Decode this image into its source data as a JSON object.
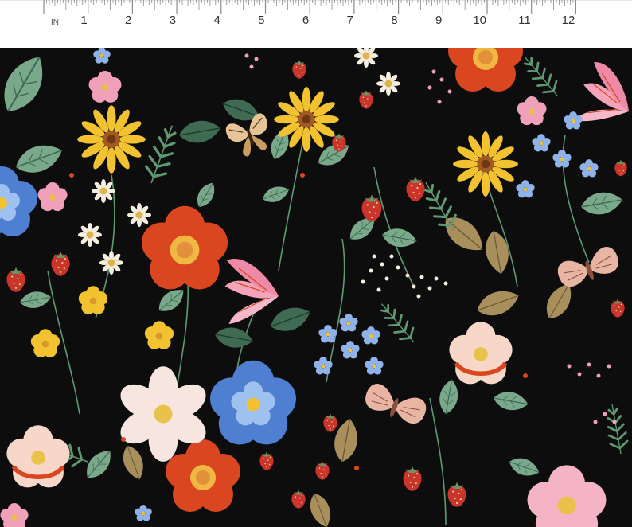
{
  "ruler": {
    "unit_label": "IN",
    "numbers": [
      "1",
      "2",
      "3",
      "4",
      "5",
      "6",
      "7",
      "8",
      "9",
      "10",
      "11",
      "12"
    ]
  },
  "colors": {
    "background": "#0d0d0d",
    "leaf_green": "#7aa88a",
    "dark_leaf": "#3f6b52",
    "red": "#d9461f",
    "yellow": "#f2c230",
    "pink": "#f0a0b8",
    "blue": "#4f7fd0",
    "cream": "#f6efe0",
    "tan": "#a88f5c",
    "strawberry": "#c9342c"
  },
  "motifs": [
    "red-flower-icon",
    "yellow-daisy-icon",
    "pink-blossom-icon",
    "blue-pansy-icon",
    "cream-cosmos-icon",
    "strawberry-icon",
    "moth-icon",
    "butterfly-icon",
    "pink-tulip-icon",
    "leaf-icon",
    "fern-icon",
    "white-daisy-icon"
  ]
}
